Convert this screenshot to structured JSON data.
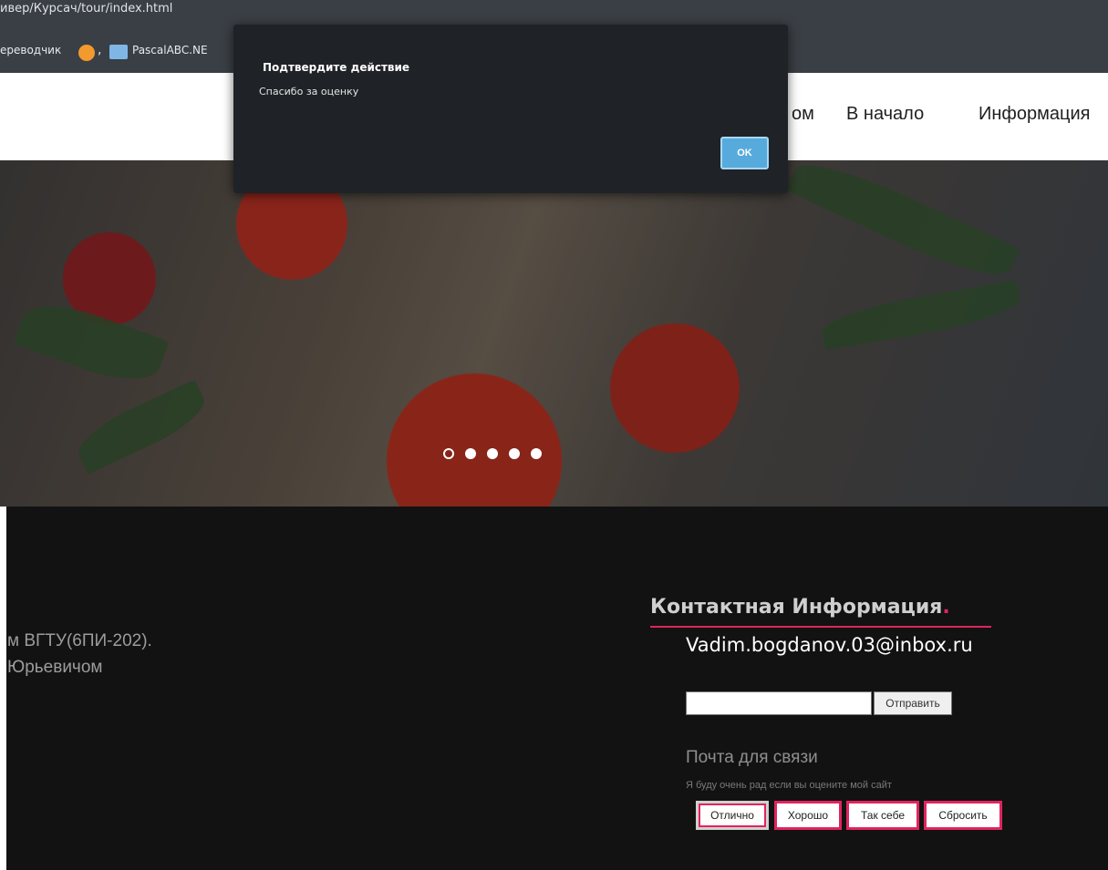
{
  "browser": {
    "address_text": "ивер/Курсач/tour/index.html",
    "bookmarks": {
      "translator": "ереводчик",
      "separator": ",",
      "pascal": "PascalABC.NE"
    }
  },
  "nav": {
    "items": [
      "ом",
      "В начало",
      "Информация"
    ]
  },
  "hero": {
    "slide_count": 5,
    "active_slide": 1
  },
  "footer": {
    "about_line_1": "м ВГТУ(6ПИ-202).",
    "about_line_2": "Юрьевичом",
    "contact_title": "Контактная Информация",
    "contact_title_dot": ".",
    "email": "Vadim.bogdanov.03@inbox.ru",
    "email_input_value": "",
    "send_label": "Отправить",
    "mail_label": "Почта для связи",
    "rating_caption": "Я буду очень рад если вы оцените мой сайт",
    "rating_buttons": [
      "Отлично",
      "Хорошо",
      "Так себе",
      "Сбросить"
    ]
  },
  "dialog": {
    "title": "Подтвердите действие",
    "message": "Спасибо за оценку",
    "ok_label": "OK"
  },
  "colors": {
    "accent": "#e0245e",
    "dialog_button": "#57aadc",
    "footer_bg": "#121212",
    "dialog_bg": "#1f2226"
  }
}
